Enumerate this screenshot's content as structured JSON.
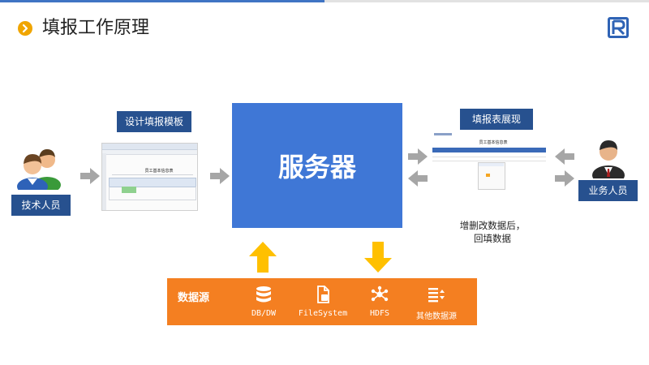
{
  "title": "填报工作原理",
  "labels": {
    "tech_staff": "技术人员",
    "design_template": "设计填报模板",
    "server": "服务器",
    "form_display": "填报表展现",
    "business_staff": "业务人员",
    "writeback_line1": "增删改数据后，",
    "writeback_line2": "回填数据"
  },
  "datasource": {
    "title": "数据源",
    "items": [
      {
        "icon": "database-icon",
        "label": "DB/DW"
      },
      {
        "icon": "file-icon",
        "label": "FileSystem"
      },
      {
        "icon": "hdfs-share-icon",
        "label": "HDFS"
      },
      {
        "icon": "list-sort-icon",
        "label": "其他数据源"
      }
    ]
  },
  "thumbnails": {
    "designer_heading": "员工基本信息表",
    "form_heading": "员工基本信息表"
  },
  "colors": {
    "accent_blue": "#3f77d6",
    "label_blue": "#27518f",
    "datasource_orange": "#f47f21",
    "arrow_yellow": "#ffc000",
    "arrow_gray": "#a6a6a6",
    "bullet_orange": "#f0a500"
  }
}
